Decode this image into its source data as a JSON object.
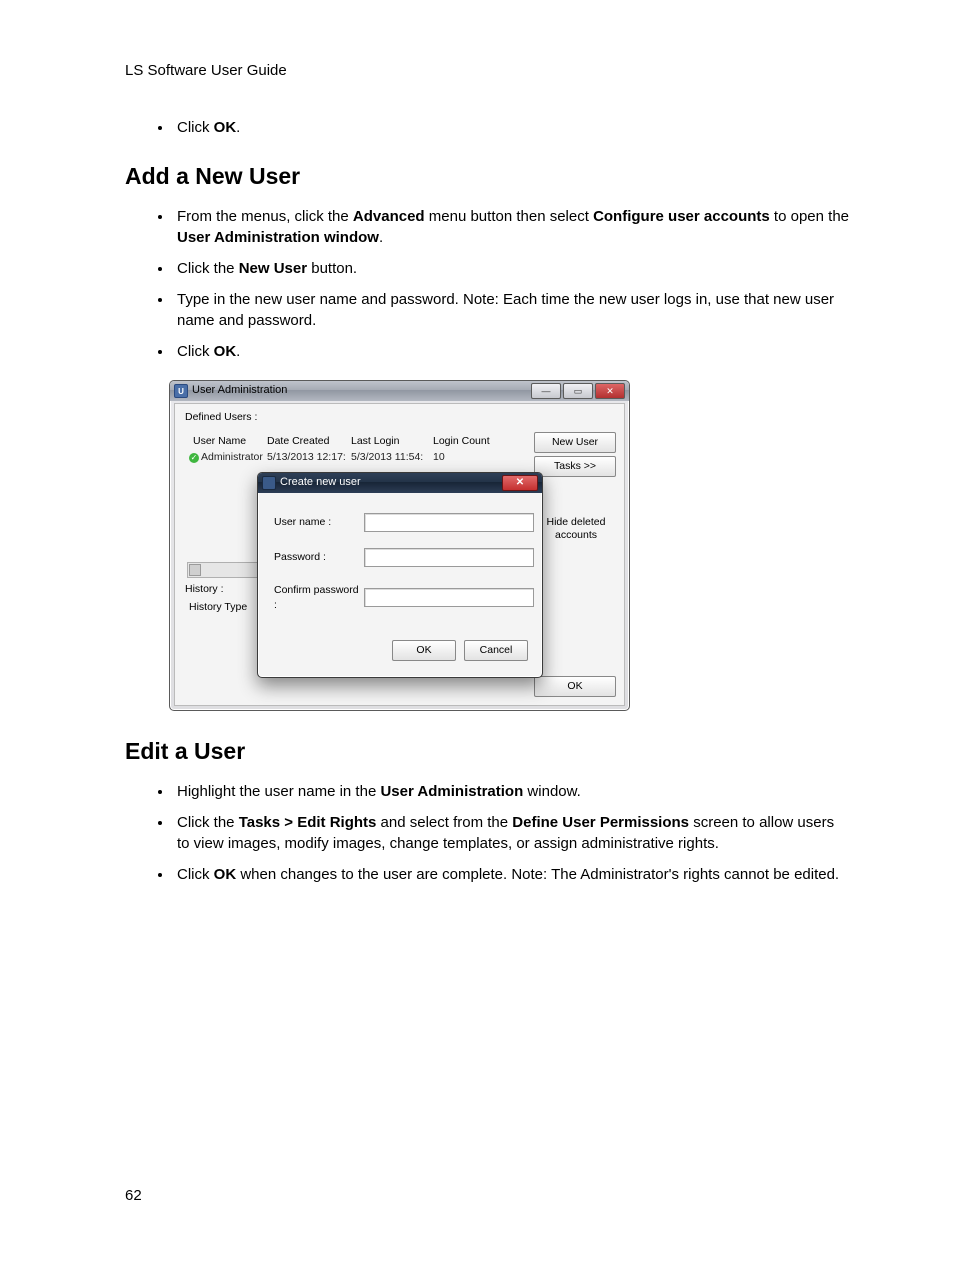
{
  "running_head": "LS Software User Guide",
  "page_number": "62",
  "pre_list": {
    "items": [
      "Click ",
      "OK",
      "."
    ]
  },
  "h_add": "Add a New User",
  "add_list": [
    {
      "parts": [
        "From the menus, click the ",
        "Advanced",
        " menu button then select ",
        "Configure user accounts",
        " to open the ",
        "User Administration window",
        "."
      ]
    },
    {
      "parts": [
        "Click the ",
        "New User",
        " button."
      ]
    },
    {
      "parts": [
        "Type in the new user name and password. Note: Each time the new user logs in, use that new user name and password."
      ]
    },
    {
      "parts": [
        "Click ",
        "OK",
        "."
      ]
    }
  ],
  "h_edit": "Edit a User",
  "edit_list": [
    {
      "parts": [
        "Highlight the user name in the ",
        "User Administration",
        " window."
      ]
    },
    {
      "parts": [
        "Click the ",
        "Tasks > Edit Rights",
        " and select from the ",
        "Define User Permissions",
        " screen to allow users to view images, modify images, change templates, or assign administrative rights."
      ]
    },
    {
      "parts": [
        "Click ",
        "OK",
        " when changes to the user are complete. Note: The Administrator's rights cannot be edited."
      ]
    }
  ],
  "win": {
    "title": "User Administration",
    "defined_users_label": "Defined Users :",
    "cols": {
      "user_name": "User Name",
      "date_created": "Date Created",
      "last_login": "Last Login",
      "login_count": "Login Count"
    },
    "row": {
      "user_name": "Administrator",
      "date_created": "5/13/2013 12:17:",
      "last_login": "5/3/2013 11:54:",
      "login_count": "10"
    },
    "history_label": "History :",
    "history_type_label": "History Type",
    "buttons": {
      "new_user": "New User",
      "tasks": "Tasks >>",
      "hide_deleted": "Hide deleted accounts",
      "ok": "OK"
    }
  },
  "dlg": {
    "title": "Create new user",
    "user_name_label": "User name :",
    "password_label": "Password  :",
    "confirm_label": "Confirm password :",
    "user_name_value": "",
    "password_value": "",
    "confirm_value": "",
    "ok": "OK",
    "cancel": "Cancel"
  }
}
